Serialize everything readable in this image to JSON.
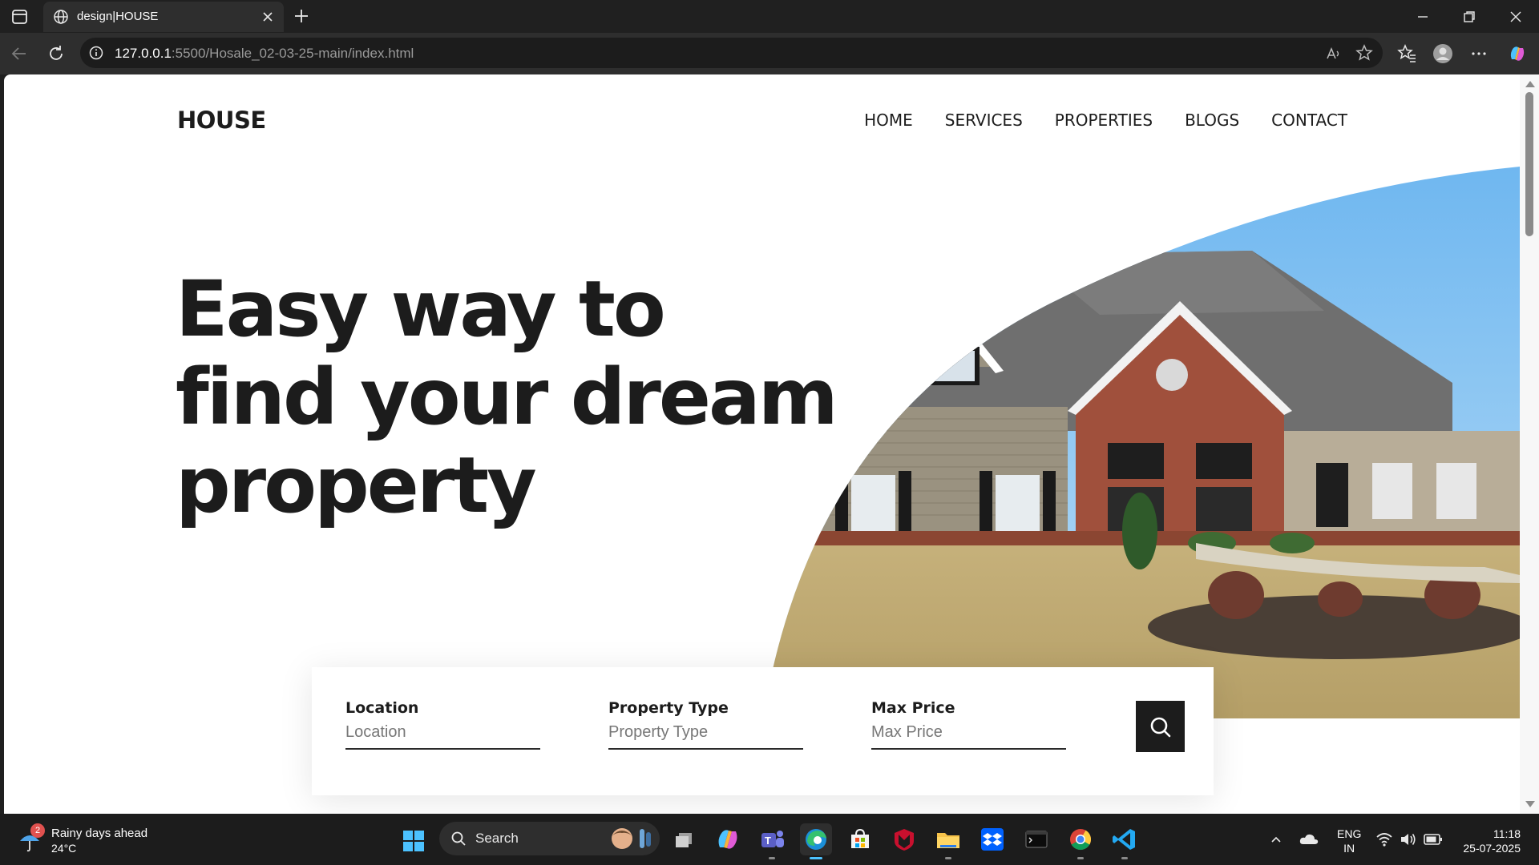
{
  "browser": {
    "tab_title": "design|HOUSE",
    "url_host": "127.0.0.1",
    "url_rest": ":5500/Hosale_02-03-25-main/index.html"
  },
  "site": {
    "logo": "HOUSE",
    "nav": [
      "HOME",
      "SERVICES",
      "PROPERTIES",
      "BLOGS",
      "CONTACT"
    ],
    "hero_lines": [
      "Easy way to",
      "find your dream",
      "property"
    ],
    "search": {
      "fields": [
        {
          "label": "Location",
          "placeholder": "Location"
        },
        {
          "label": "Property Type",
          "placeholder": "Property Type"
        },
        {
          "label": "Max Price",
          "placeholder": "Max Price"
        }
      ]
    }
  },
  "taskbar": {
    "weather_badge": "2",
    "weather_title": "Rainy days ahead",
    "weather_temp": "24°C",
    "search_label": "Search",
    "lang_top": "ENG",
    "lang_bottom": "IN",
    "time": "11:18",
    "date": "25-07-2025"
  },
  "colors": {
    "text_dark": "#1c1c1c",
    "accent_edge": "#4cc2ff",
    "sky": "#8ec8ee"
  }
}
